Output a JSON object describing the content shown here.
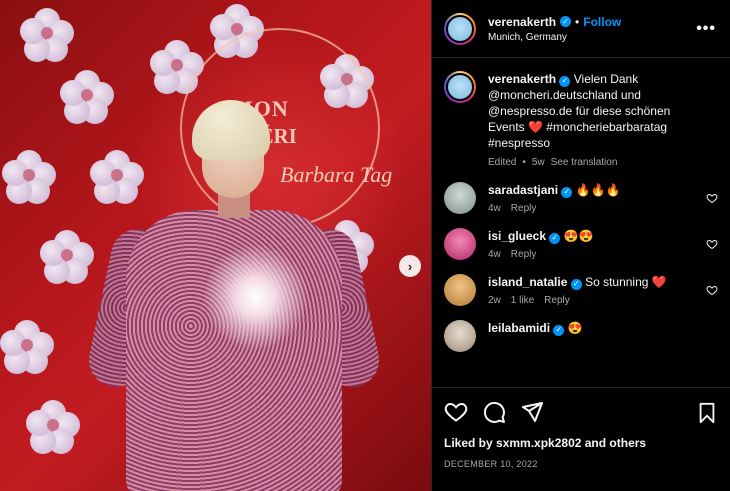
{
  "post": {
    "author": "verenakerth",
    "location": "Munich, Germany",
    "follow_label": "Follow",
    "separator": "•",
    "more_label": "•••"
  },
  "caption": {
    "username": "verenakerth",
    "text": "Vielen Dank @moncheri.deutschland und @nespresso.de für diese schönen Events ❤️ #moncheriebarbaratag #nespresso",
    "edited": "Edited",
    "age": "5w",
    "see_translation": "See translation"
  },
  "comments": [
    {
      "username": "saradastjani",
      "text": "🔥🔥🔥",
      "age": "4w",
      "reply": "Reply",
      "likes": ""
    },
    {
      "username": "isi_glueck",
      "text": "😍😍",
      "age": "4w",
      "reply": "Reply",
      "likes": ""
    },
    {
      "username": "island_natalie",
      "text": "So stunning ❤️",
      "age": "2w",
      "reply": "Reply",
      "likes": "1 like"
    },
    {
      "username": "leilabamidi",
      "text": "😍",
      "age": "",
      "reply": "",
      "likes": ""
    }
  ],
  "footer": {
    "liked_prefix": "Liked by ",
    "liked_user": "sxmm.xpk2802",
    "liked_suffix": " and others",
    "date": "DECEMBER 10, 2022"
  },
  "photo_text": {
    "brand_line1": "MON",
    "brand_line2": "CHÉRI",
    "script": "Barbara Tag"
  },
  "colors": {
    "accent": "#0095f6",
    "background": "#000000",
    "secondary_text": "#a8a8a8",
    "like_red": "#ff3040"
  },
  "icons": [
    "verified-icon",
    "more-icon",
    "heart-icon",
    "comment-icon",
    "share-icon",
    "bookmark-icon",
    "chevron-right-icon"
  ]
}
